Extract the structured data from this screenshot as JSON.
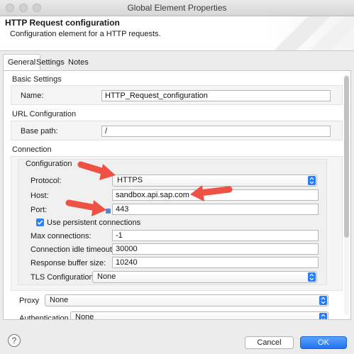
{
  "window": {
    "title": "Global Element Properties"
  },
  "header": {
    "title": "HTTP Request configuration",
    "description": "Configuration element for a HTTP requests."
  },
  "tabs": [
    {
      "label": "General",
      "active": true
    },
    {
      "label": "Settings",
      "active": false
    },
    {
      "label": "Notes",
      "active": false
    }
  ],
  "basic": {
    "section_label": "Basic Settings",
    "name_label": "Name:",
    "name_value": "HTTP_Request_configuration"
  },
  "url": {
    "section_label": "URL Configuration",
    "base_path_label": "Base path:",
    "base_path_value": "/"
  },
  "connection": {
    "section_label": "Connection",
    "config_label": "Configuration",
    "protocol_label": "Protocol:",
    "protocol_value": "HTTPS",
    "host_label": "Host:",
    "host_value": "sandbox.api.sap.com",
    "port_label": "Port:",
    "port_value": "443",
    "persistent_label": "Use persistent connections",
    "persistent_checked": true,
    "max_conn_label": "Max connections:",
    "max_conn_value": "-1",
    "idle_timeout_label": "Connection idle timeout:",
    "idle_timeout_value": "30000",
    "buffer_label": "Response buffer size:",
    "buffer_value": "10240",
    "tls_label": "TLS Configuration",
    "tls_value": "None"
  },
  "proxy": {
    "label": "Proxy",
    "value": "None"
  },
  "auth": {
    "label": "Authentication",
    "value": "None"
  },
  "footer": {
    "cancel_label": "Cancel",
    "ok_label": "OK"
  },
  "colors": {
    "accent": "#2b7cf0",
    "arrow": "#ee5244"
  },
  "icons": {
    "help": "help-icon",
    "dropdown": "chevron-updown-icon",
    "check": "checkmark-icon",
    "annotation": "red-arrow-icon"
  }
}
